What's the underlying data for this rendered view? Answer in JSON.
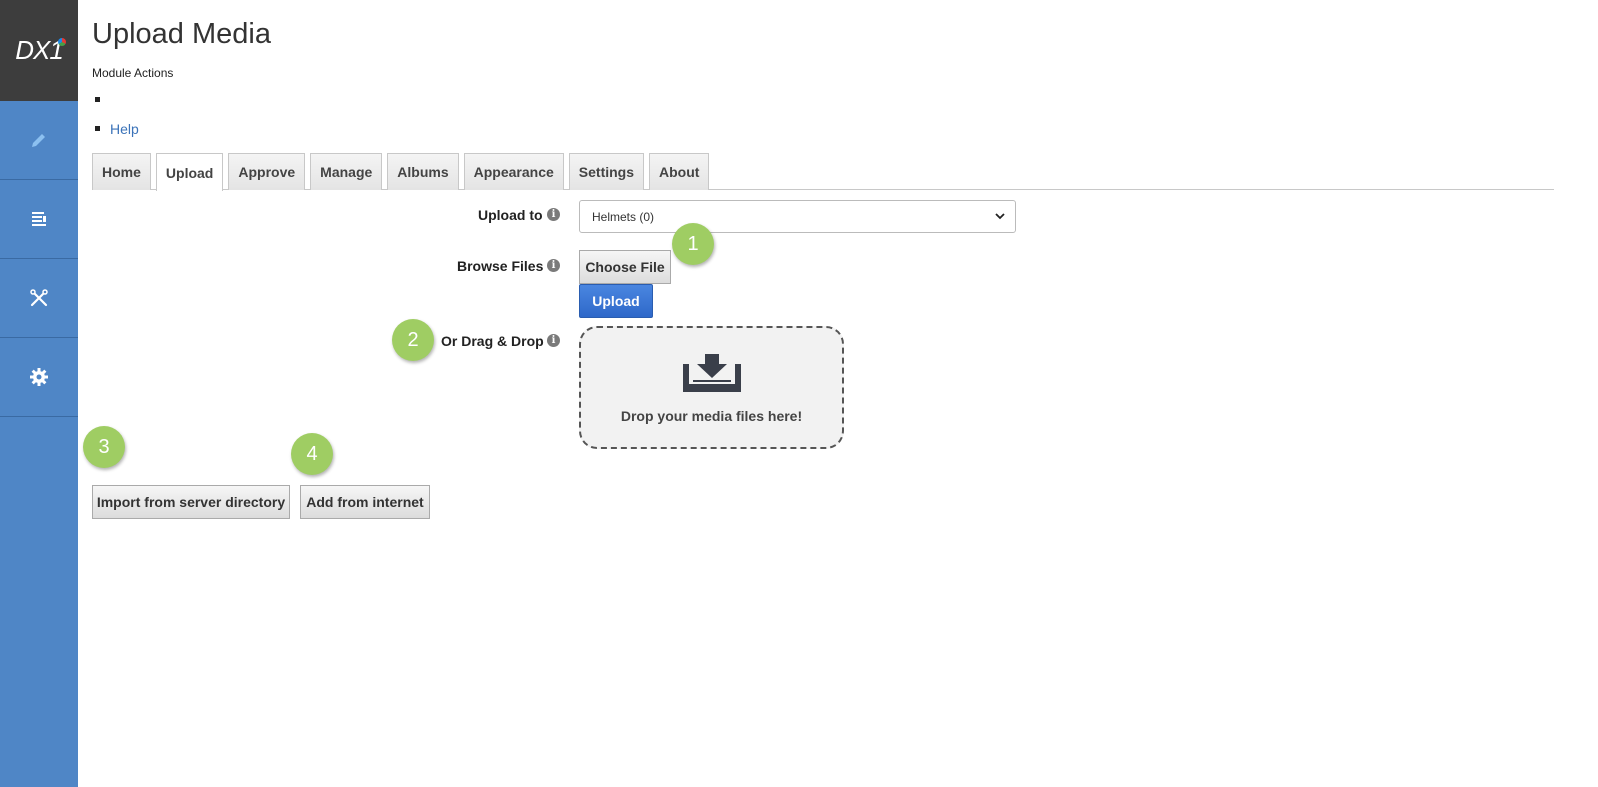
{
  "sidebar": {
    "logo_text": "DX1",
    "items": [
      {
        "name": "edit",
        "icon": "pencil-icon"
      },
      {
        "name": "content",
        "icon": "content-list-icon"
      },
      {
        "name": "tools",
        "icon": "tools-icon"
      },
      {
        "name": "settings",
        "icon": "gear-icon"
      }
    ],
    "color": "#4f86c6"
  },
  "header": {
    "title": "Upload Media",
    "module_actions": "Module Actions",
    "help_link": "Help"
  },
  "tabs": [
    {
      "label": "Home"
    },
    {
      "label": "Upload",
      "active": true
    },
    {
      "label": "Approve"
    },
    {
      "label": "Manage"
    },
    {
      "label": "Albums"
    },
    {
      "label": "Appearance"
    },
    {
      "label": "Settings"
    },
    {
      "label": "About"
    }
  ],
  "form": {
    "upload_to_label": "Upload to",
    "upload_to_value": "Helmets (0)",
    "browse_files_label": "Browse Files",
    "choose_file_label": "Choose File",
    "upload_button": "Upload",
    "drag_drop_label": "Or Drag & Drop",
    "drop_text": "Drop your media files here!"
  },
  "actions": {
    "import_server": "Import from server directory",
    "add_internet": "Add from internet"
  },
  "badges": [
    "1",
    "2",
    "3",
    "4"
  ]
}
